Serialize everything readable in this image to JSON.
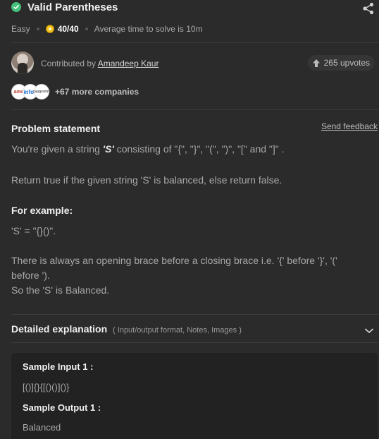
{
  "header": {
    "title": "Valid Parentheses",
    "difficulty": "Easy",
    "score": "40/40",
    "avg_time": "Average time to solve is 10m"
  },
  "contributor": {
    "prefix": "Contributed by",
    "name": "Amandeep Kaur",
    "upvotes": "265 upvotes"
  },
  "companies": {
    "logos": [
      "amd",
      "infoe",
      "capgemini"
    ],
    "more": "+67 more companies"
  },
  "problem": {
    "heading": "Problem statement",
    "feedback_label": "Send feedback",
    "line1_pre": "You're given a string",
    "line1_var": "'S'",
    "line1_post": "consisting of \"{\", \"}\", \"(\", \")\", \"[\" and \"]\" .",
    "line2": "Return true if the given string 'S' is balanced, else return false.",
    "example_heading": "For example:",
    "example_value": "'S' = \"{}()\".",
    "explain1": "There is always an opening brace before a closing brace i.e. '{' before '}', '(' before ').",
    "explain2": "So the 'S' is Balanced."
  },
  "detail": {
    "heading": "Detailed explanation",
    "sub": "( Input/output format, Notes, Images )"
  },
  "sample": {
    "input_label": "Sample Input 1 :",
    "input_value": "[()]{}{[()()]()}",
    "output_label": "Sample Output 1 :",
    "output_value": "Balanced"
  },
  "colors": {
    "background": "#2b2b2b",
    "success": "#43c17a",
    "coin": "#f4c21b"
  }
}
